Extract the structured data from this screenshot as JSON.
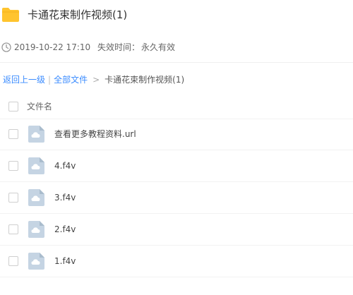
{
  "header": {
    "folder_icon": "folder-icon",
    "title": "卡通花束制作视频(1)",
    "folder_color": "#ffc42e"
  },
  "meta": {
    "clock_icon": "clock-icon",
    "date": "2019-10-22 17:10",
    "expire_label": "失效时间：",
    "expire_value": "永久有效"
  },
  "breadcrumb": {
    "back": "返回上一级",
    "separator": "|",
    "all_files": "全部文件",
    "arrow": ">",
    "current": "卡通花束制作视频(1)",
    "link_color": "#3b8cff"
  },
  "list": {
    "column_name": "文件名",
    "files": [
      {
        "name": "查看更多教程资料.url",
        "icon": "cloud-file-icon"
      },
      {
        "name": "4.f4v",
        "icon": "cloud-file-icon"
      },
      {
        "name": "3.f4v",
        "icon": "cloud-file-icon"
      },
      {
        "name": "2.f4v",
        "icon": "cloud-file-icon"
      },
      {
        "name": "1.f4v",
        "icon": "cloud-file-icon"
      }
    ]
  }
}
